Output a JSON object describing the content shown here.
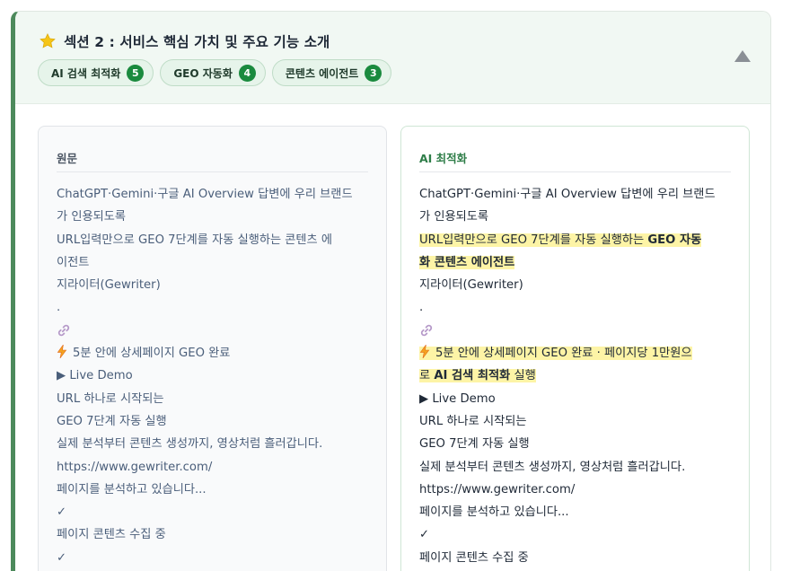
{
  "section": {
    "title": "섹션 2 : 서비스 핵심 가치 및 주요 기능 소개",
    "badges": [
      {
        "label": "AI 검색 최적화",
        "count": "5"
      },
      {
        "label": "GEO 자동화",
        "count": "4"
      },
      {
        "label": "콘텐츠 에이전트",
        "count": "3"
      }
    ]
  },
  "original": {
    "label": "원문",
    "lines": [
      "ChatGPT·Gemini·구글 AI Overview 답변에 우리 브랜드",
      "가 인용되도록",
      "URL입력만으로 GEO 7단계를 자동 실행하는 콘텐츠 에",
      "이전트",
      "지라이터(Gewriter)",
      ".",
      "",
      "5분 안에 상세페이지 GEO 완료",
      "▶ Live Demo",
      "URL 하나로 시작되는",
      "GEO 7단계 자동 실행",
      "실제 분석부터 콘텐츠 생성까지, 영상처럼 흘러갑니다.",
      "https://www.gewriter.com/",
      "페이지를 분석하고 있습니다...",
      "✓",
      "페이지 콘텐츠 수집 중",
      "✓"
    ]
  },
  "optimized": {
    "label": "AI 최적화",
    "line1": "ChatGPT·Gemini·구글 AI Overview 답변에 우리 브랜드",
    "line2": "가 인용되도록",
    "line3_plain": "URL입력만으로 GEO 7단계를 자동 실행하는 ",
    "line3_strong": "GEO 자동",
    "line4_strong": "화 콘텐츠 에이전트",
    "line5": "지라이터(Gewriter)",
    "line6": ".",
    "line8": "5분 안에 상세페이지 GEO 완료 · 페이지당 1만원으",
    "line9_pre": "로 ",
    "line9_strong": "AI 검색 최적화",
    "line9_post": " 실행",
    "line10": "▶ Live Demo",
    "line11": "URL 하나로 시작되는",
    "line12": "GEO 7단계 자동 실행",
    "line13": "실제 분석부터 콘텐츠 생성까지, 영상처럼 흘러갑니다.",
    "line14": "https://www.gewriter.com/",
    "line15": "페이지를 분석하고 있습니다...",
    "line16": "✓",
    "line17": "페이지 콘텐츠 수집 중"
  },
  "colors": {
    "accent": "#4d8a5c",
    "badge_count": "#1a8a3e",
    "highlight": "#fdf4a6"
  },
  "icons": [
    "star-icon",
    "link-icon",
    "lightning-icon",
    "collapse-arrow-icon"
  ]
}
